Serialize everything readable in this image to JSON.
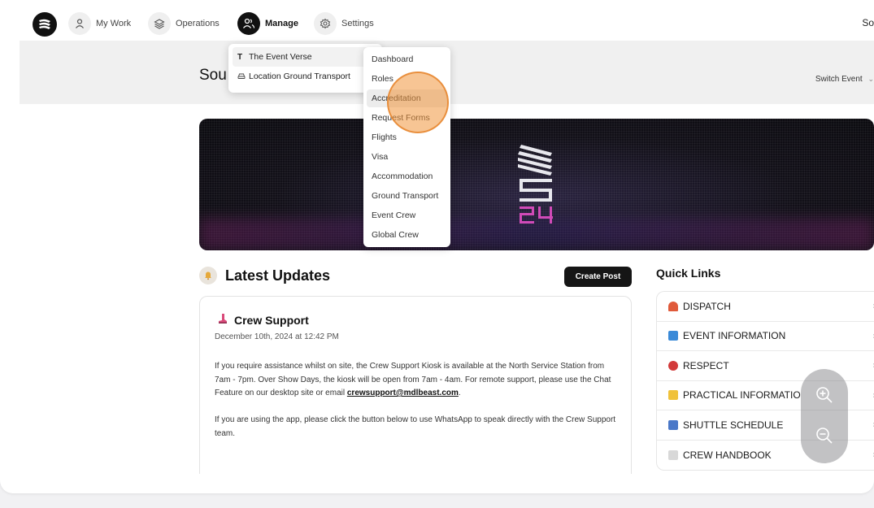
{
  "nav": {
    "items": [
      {
        "label": "My Work",
        "icon": "user-icon"
      },
      {
        "label": "Operations",
        "icon": "layers-icon"
      },
      {
        "label": "Manage",
        "icon": "team-icon"
      },
      {
        "label": "Settings",
        "icon": "gear-icon"
      }
    ],
    "right_text": "So"
  },
  "header": {
    "title": "Sou",
    "switch_event": "Switch Event"
  },
  "latest_updates": {
    "title": "Latest Updates",
    "create_post": "Create Post",
    "post": {
      "title": "Crew Support",
      "date": "December 10th, 2024 at 12:42 PM",
      "p1_before": "If you require assistance whilst on site, the Crew Support Kiosk is available at the North Service Station from 7am - 7pm. Over Show Days, the kiosk will be open from 7am - 4am. For remote support, please use the Chat Feature on our desktop site or email ",
      "p1_link": "crewsupport@mdlbeast.com",
      "p1_after": ".",
      "p2": "If you are using the app, please click the button below to use WhatsApp to speak directly with the Crew Support team."
    }
  },
  "quick_links": {
    "title": "Quick Links",
    "items": [
      {
        "label": "DISPATCH",
        "color": "#e05a3a"
      },
      {
        "label": "EVENT INFORMATION",
        "color": "#3a8ad8"
      },
      {
        "label": "RESPECT",
        "color": "#d23a3a"
      },
      {
        "label": "PRACTICAL INFORMATIO",
        "color": "#f0c23a"
      },
      {
        "label": "SHUTTLE SCHEDULE",
        "color": "#4a78c8"
      },
      {
        "label": "CREW HANDBOOK",
        "color": "#b8b8b8"
      }
    ]
  },
  "manage_menu": {
    "items": [
      {
        "prefix": "T",
        "label": "The Event Verse",
        "arrow": ">"
      },
      {
        "prefix": "",
        "label": "Location Ground Transport",
        "arrow": ""
      }
    ]
  },
  "submenu": {
    "items": [
      "Dashboard",
      "Roles",
      "Accreditation",
      "Request Forms",
      "Flights",
      "Visa",
      "Accommodation",
      "Ground Transport",
      "Event Crew",
      "Global Crew"
    ],
    "hovered": "Accreditation"
  }
}
